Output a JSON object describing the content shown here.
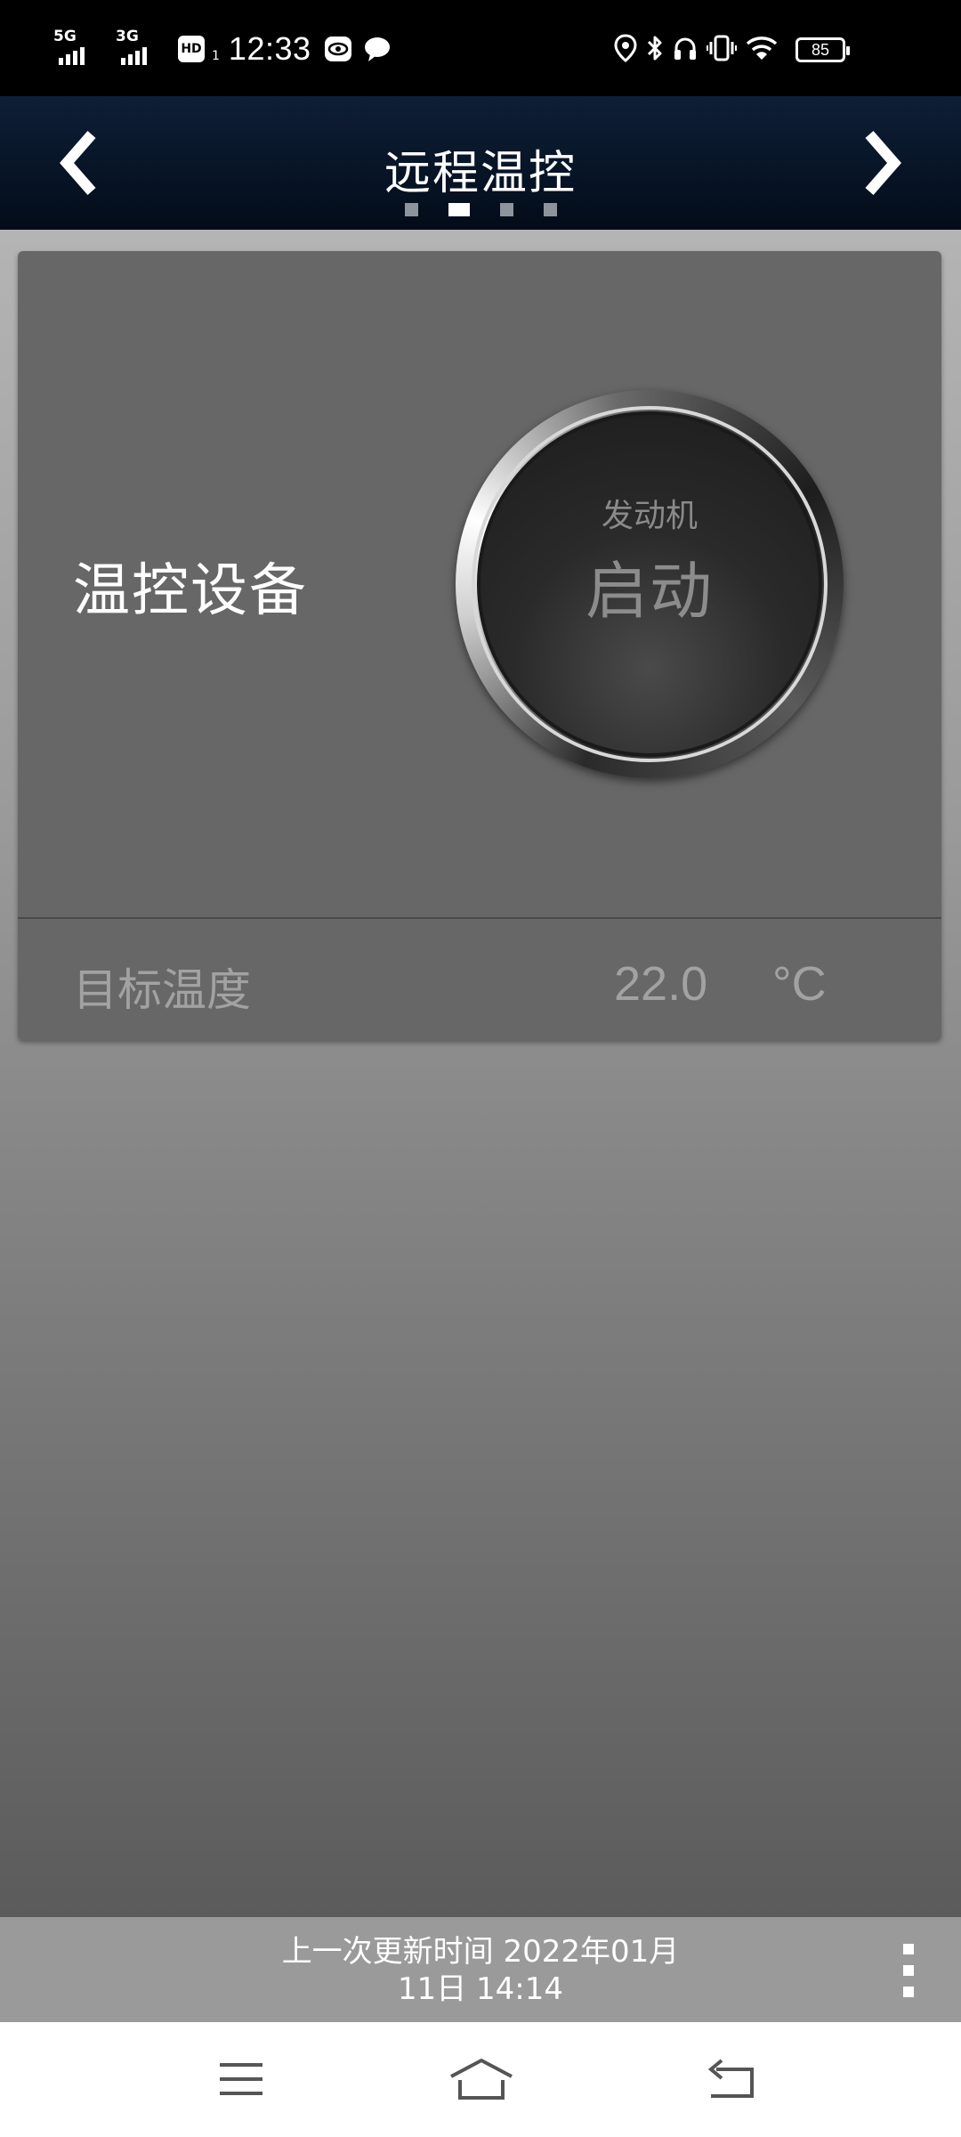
{
  "status_bar": {
    "signal_1_type": "5G",
    "signal_2_type": "3G",
    "hd_badge": "HD",
    "hd_sub": "1",
    "time": "12:33",
    "battery_level": "85"
  },
  "header": {
    "title": "远程温控",
    "page_count": 4,
    "active_page_index": 1
  },
  "card": {
    "device_label": "温控设备",
    "button": {
      "sub_label": "发动机",
      "main_label": "启动"
    },
    "target_temp_label": "目标温度",
    "target_temp_value": "22.0",
    "target_temp_unit": "°C"
  },
  "footer": {
    "update_line_1": "上一次更新时间  2022年01月",
    "update_line_2": "11日  14:14"
  },
  "icons": {
    "prev": "chevron-left-icon",
    "next": "chevron-right-icon",
    "more": "more-vertical-icon",
    "menu": "menu-icon",
    "home": "home-icon",
    "back": "back-icon"
  },
  "colors": {
    "header_bg": "#071426",
    "card_bg": "#676767",
    "update_bar_bg": "#9a9a9a",
    "accent_white": "#ffffff"
  }
}
